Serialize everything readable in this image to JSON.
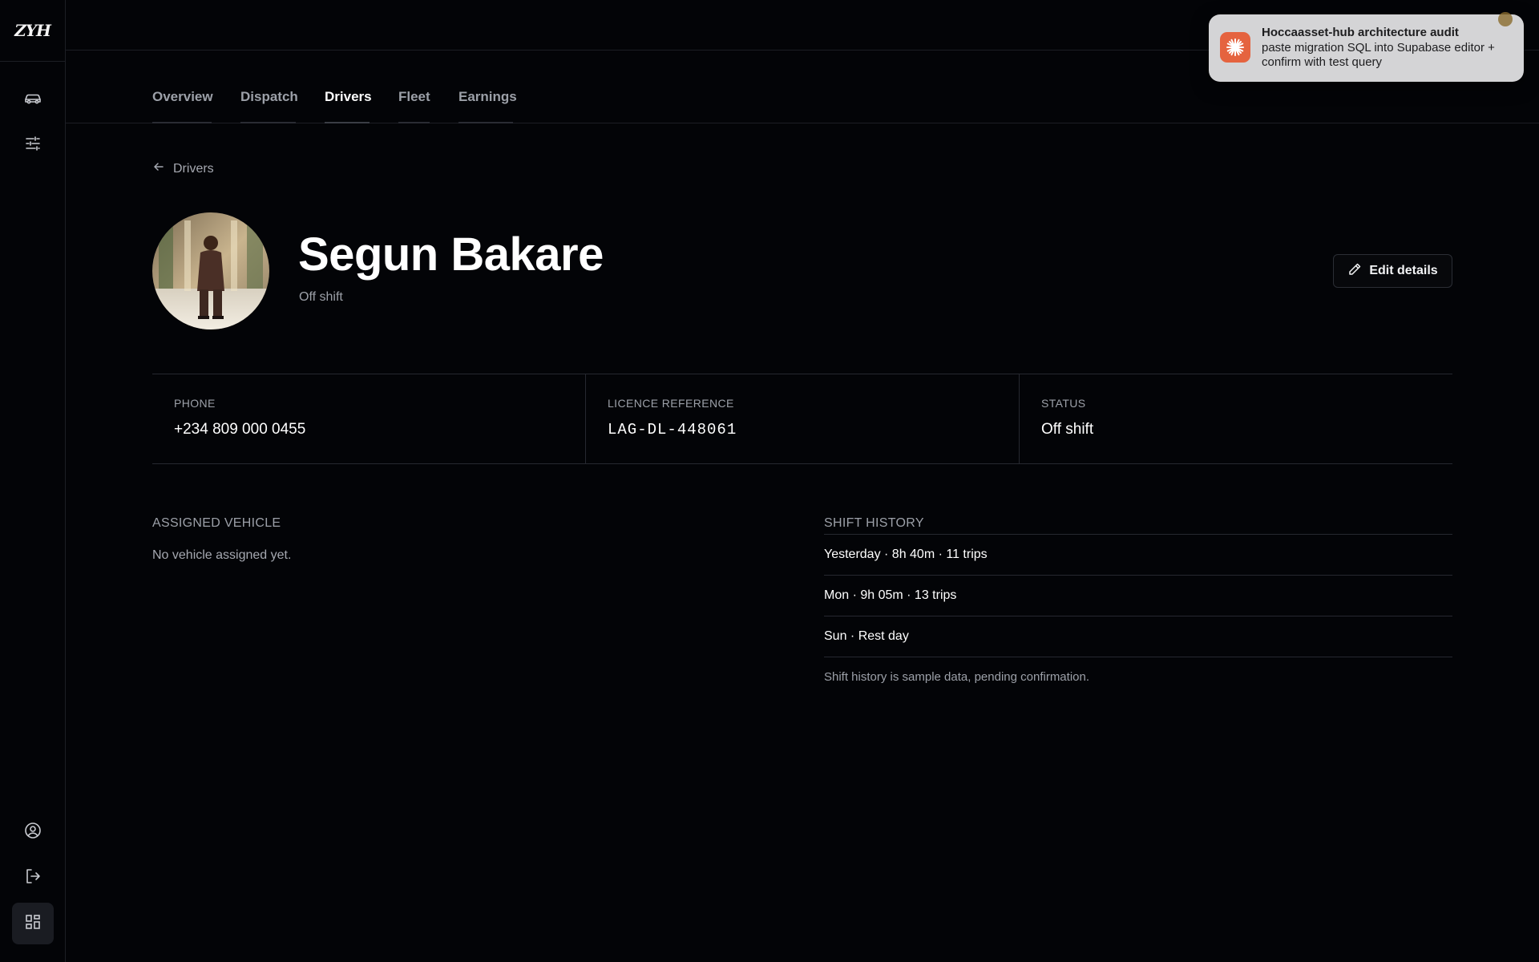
{
  "app": {
    "logo_text": "ZYH"
  },
  "sidebar": {
    "top_items": [
      {
        "icon": "car-icon"
      },
      {
        "icon": "sliders-icon"
      }
    ],
    "bottom_items": [
      {
        "icon": "user-circle-icon"
      },
      {
        "icon": "logout-icon"
      },
      {
        "icon": "grid-icon"
      }
    ]
  },
  "tabs": [
    {
      "label": "Overview",
      "active": false
    },
    {
      "label": "Dispatch",
      "active": false
    },
    {
      "label": "Drivers",
      "active": true
    },
    {
      "label": "Fleet",
      "active": false
    },
    {
      "label": "Earnings",
      "active": false
    }
  ],
  "breadcrumb": {
    "back_label": "Drivers"
  },
  "driver": {
    "name": "Segun Bakare",
    "subtitle": "Off shift",
    "edit_label": "Edit details"
  },
  "info": [
    {
      "label": "PHONE",
      "value": "+234 809 000 0455"
    },
    {
      "label": "LICENCE REFERENCE",
      "value": "LAG-DL-448061"
    },
    {
      "label": "STATUS",
      "value": "Off shift"
    }
  ],
  "assigned_vehicle": {
    "title": "ASSIGNED VEHICLE",
    "empty_text": "No vehicle assigned yet."
  },
  "shift_history": {
    "title": "SHIFT HISTORY",
    "rows": [
      "Yesterday · 8h 40m · 11 trips",
      "Mon · 9h 05m · 13 trips",
      "Sun · Rest day"
    ],
    "note": "Shift history is sample data, pending confirmation."
  },
  "notification": {
    "title": "Hoccaasset-hub architecture audit",
    "body": "paste migration SQL into Supabase editor + confirm with test query",
    "icon": "sparkle-icon",
    "accent": "#e5633f"
  },
  "colors": {
    "background": "#030407",
    "border": "#262830",
    "text_muted": "#9ca0a8"
  }
}
